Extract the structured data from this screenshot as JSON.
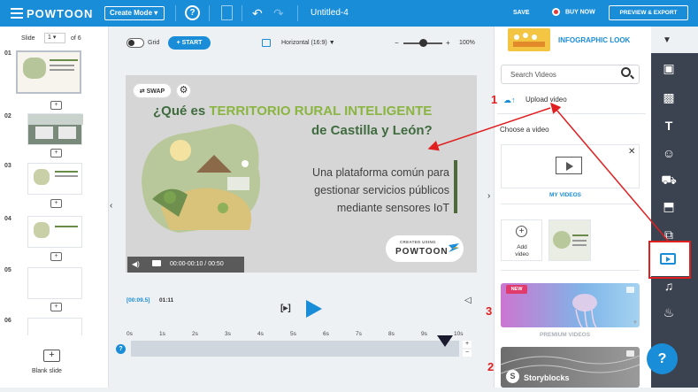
{
  "topbar": {
    "logo": "POWTOON",
    "create_mode": "Create Mode ▾",
    "title": "Untitled-4",
    "save": "SAVE",
    "buy_now": "BUY NOW",
    "preview_export": "PREVIEW & EXPORT"
  },
  "slides_panel": {
    "slide_label": "Slide",
    "current": "1",
    "of_label": "of 6",
    "numbers": [
      "01",
      "02",
      "03",
      "04",
      "05",
      "06"
    ],
    "blank_slide": "Blank slide"
  },
  "canvas": {
    "grid_label": "Grid",
    "start_label": "START",
    "orientation": "Horizontal (16:9)",
    "zoom": "100%",
    "swap_label": "SWAP",
    "heading_part1": "¿Qué es ",
    "heading_highlight": "TERRITORIO RURAL INTELIGENTE",
    "heading_line2": "de Castilla y León?",
    "body_lines": [
      "Una plataforma común para",
      "gestionar servicios públicos",
      "mediante sensores IoT"
    ],
    "badge_created": "CREATED USING",
    "badge_brand": "POWTOON",
    "player_time": "00:00-00:10 / 00:50",
    "colors": {
      "heading": "#3f6b3f",
      "highlight": "#8ab540"
    }
  },
  "timeline": {
    "current": "[00:09.5]",
    "total": "01:11",
    "ticks": [
      "0s",
      "1s",
      "2s",
      "3s",
      "4s",
      "5s",
      "6s",
      "7s",
      "8s",
      "9s",
      "10s"
    ],
    "plus": "+",
    "minus": "−"
  },
  "right_panel": {
    "category": "INFOGRAPHIC LOOK",
    "search_placeholder": "Search Videos",
    "upload_label": "Upload video",
    "choose_label": "Choose a video",
    "my_videos": "MY VIDEOS",
    "add_video": "Add video",
    "new_badge": "NEW",
    "premium_videos": "PREMIUM VIDEOS",
    "storyblocks": "Storyblocks"
  },
  "annotations": {
    "n1": "1",
    "n2": "2",
    "n3": "3"
  },
  "accent": "#1a8dd8"
}
